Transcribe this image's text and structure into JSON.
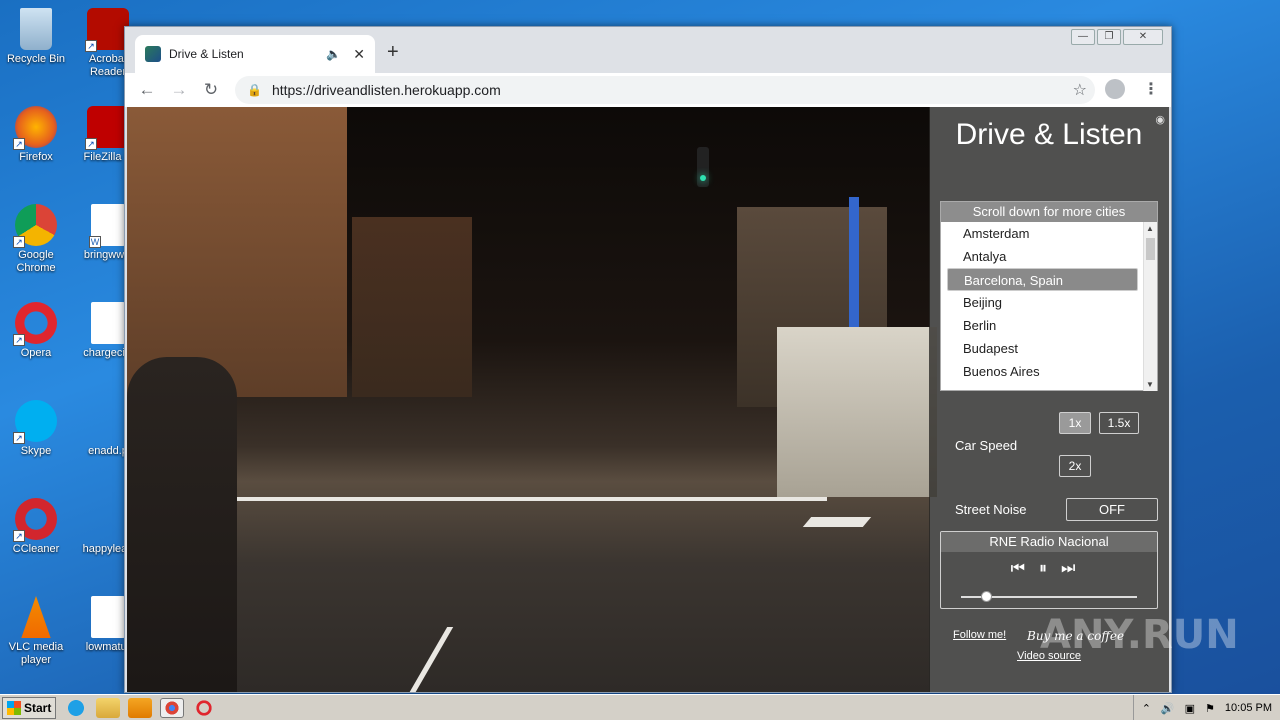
{
  "desktop": {
    "icons": [
      {
        "label": "Recycle Bin"
      },
      {
        "label": "Acrobat Reader"
      },
      {
        "label": "Firefox"
      },
      {
        "label": "FileZilla C"
      },
      {
        "label": "Google Chrome"
      },
      {
        "label": "bringwww"
      },
      {
        "label": "Opera"
      },
      {
        "label": "chargecivi"
      },
      {
        "label": "Skype"
      },
      {
        "label": "enadd.p"
      },
      {
        "label": "CCleaner"
      },
      {
        "label": "happylean"
      },
      {
        "label": "VLC media player"
      },
      {
        "label": "lowmatur"
      }
    ]
  },
  "browser": {
    "tab_title": "Drive & Listen",
    "new_tab": "+",
    "url": "https://driveandlisten.herokuapp.com",
    "window_controls": {
      "minimize": "—",
      "restore": "❐",
      "close": "✕"
    }
  },
  "page": {
    "brand": "Drive & Listen",
    "city_header": "Scroll down for more cities",
    "cities": [
      "Amsterdam",
      "Antalya",
      "Barcelona, Spain",
      "Beijing",
      "Berlin",
      "Budapest",
      "Buenos Aires"
    ],
    "selected_city": "Barcelona, Spain",
    "speed_label": "Car Speed",
    "speed_options": [
      "1x",
      "1.5x",
      "2x"
    ],
    "active_speed": "1x",
    "noise_label": "Street Noise",
    "noise_value": "OFF",
    "station": "RNE Radio Nacional",
    "volume_level": 0.14,
    "follow_link": "Follow me!",
    "coffee_link": "Buy me a coffee",
    "video_source_link": "Video source"
  },
  "watermark": "ANY.RUN",
  "taskbar": {
    "start_label": "Start",
    "time": "10:05 PM"
  }
}
